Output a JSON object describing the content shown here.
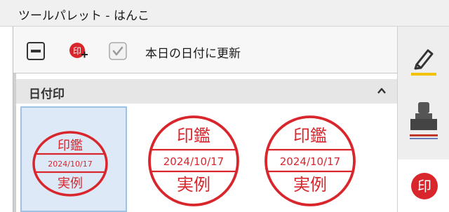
{
  "window": {
    "title": "ツールパレット - はんこ"
  },
  "toolbar": {
    "buttons": [
      {
        "name": "minus",
        "icon": "minus-square-icon"
      },
      {
        "name": "add-stamp",
        "icon": "add-stamp-icon"
      },
      {
        "name": "checkbox",
        "icon": "checkbox-icon",
        "checked": true
      }
    ],
    "update_label": "本日の日付に更新"
  },
  "section": {
    "title": "日付印",
    "collapse_icon": "chevron-up-icon"
  },
  "stamps": [
    {
      "top": "印鑑",
      "date": "2024/10/17",
      "bottom": "実例",
      "selected": true
    },
    {
      "top": "印鑑",
      "date": "2024/10/17",
      "bottom": "実例",
      "selected": false
    },
    {
      "top": "印鑑",
      "date": "2024/10/17",
      "bottom": "実例",
      "selected": false
    }
  ],
  "right_tabs": [
    {
      "name": "pen",
      "icon": "pen-icon"
    },
    {
      "name": "stamp",
      "icon": "stamp-icon"
    },
    {
      "name": "hanko",
      "icon": "hanko-icon",
      "label": "印",
      "active": true
    }
  ],
  "colors": {
    "stamp_red": "#d9262c",
    "selection_bg": "#dde9f7",
    "selection_border": "#9cc2e6",
    "pen_accent": "#f2c200",
    "stamp_accent": "#c0392b"
  }
}
